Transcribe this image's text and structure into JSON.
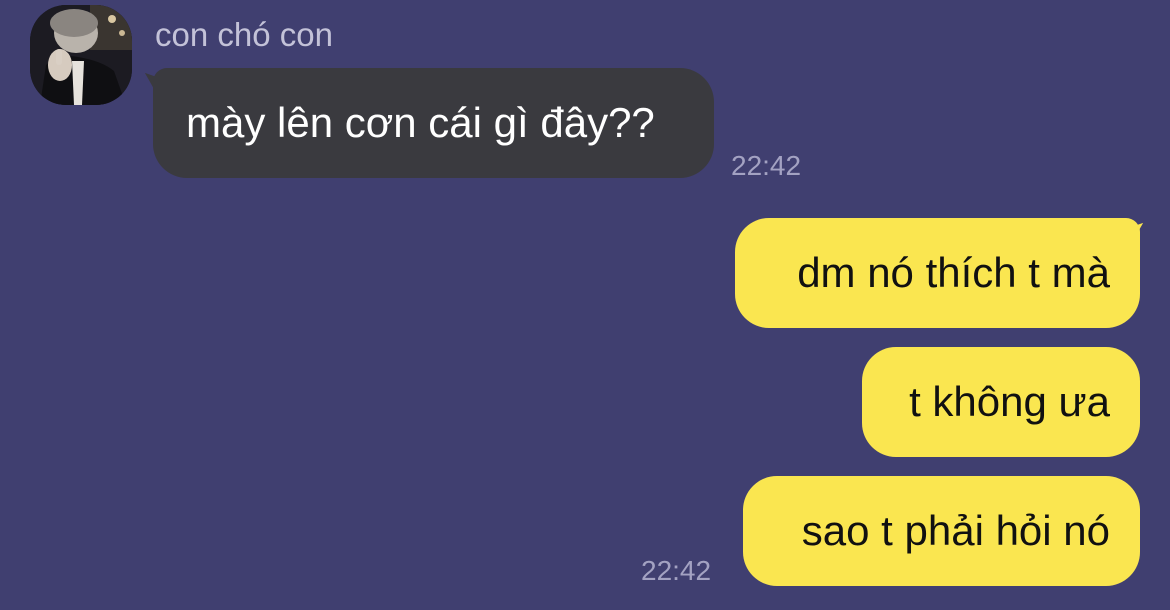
{
  "chat": {
    "contact": {
      "name": "con chó con",
      "avatar_icon": "profile-photo"
    },
    "messages": [
      {
        "direction": "incoming",
        "text": "mày lên cơn cái gì đây??",
        "time": "22:42"
      },
      {
        "direction": "outgoing",
        "text": "dm nó thích t mà"
      },
      {
        "direction": "outgoing",
        "text": "t không ưa"
      },
      {
        "direction": "outgoing",
        "text": "sao t phải hỏi nó",
        "time": "22:42"
      }
    ]
  },
  "colors": {
    "background": "#403f70",
    "incoming_bubble": "#3a3a3f",
    "outgoing_bubble": "#fae650",
    "meta_text": "#a3a2c2"
  }
}
